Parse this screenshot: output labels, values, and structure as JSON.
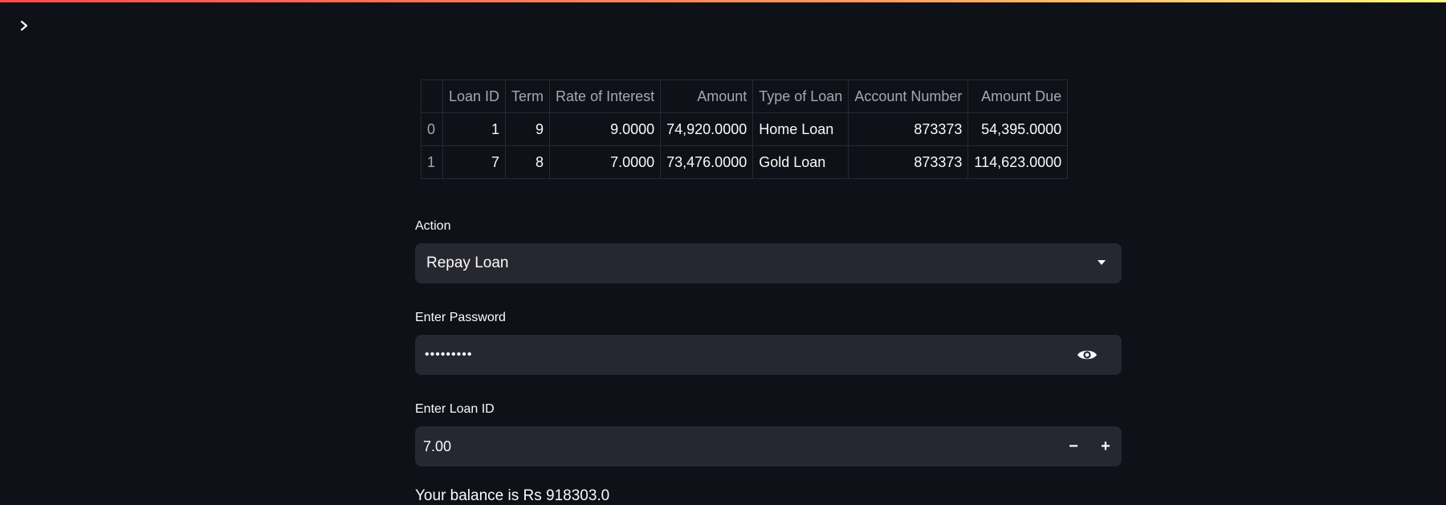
{
  "table": {
    "columns": [
      "",
      "Loan ID",
      "Term",
      "Rate of Interest",
      "Amount",
      "Type of Loan",
      "Account Number",
      "Amount Due"
    ],
    "rows": [
      [
        "0",
        "1",
        "9",
        "9.0000",
        "74,920.0000",
        "Home Loan",
        "873373",
        "54,395.0000"
      ],
      [
        "1",
        "7",
        "8",
        "7.0000",
        "73,476.0000",
        "Gold Loan",
        "873373",
        "114,623.0000"
      ]
    ]
  },
  "action": {
    "label": "Action",
    "value": "Repay Loan"
  },
  "password": {
    "label": "Enter Password",
    "value": "•••••••••",
    "icon": "eye-icon"
  },
  "loan_id": {
    "label": "Enter Loan ID",
    "value": "7.00",
    "minus": "−",
    "plus": "+"
  },
  "balance_text": "Your balance is Rs 918303.0",
  "colors": {
    "background": "#0e1117",
    "input_bg": "#262730",
    "accent_start": "#ff4b4b",
    "accent_end": "#fffd80"
  }
}
